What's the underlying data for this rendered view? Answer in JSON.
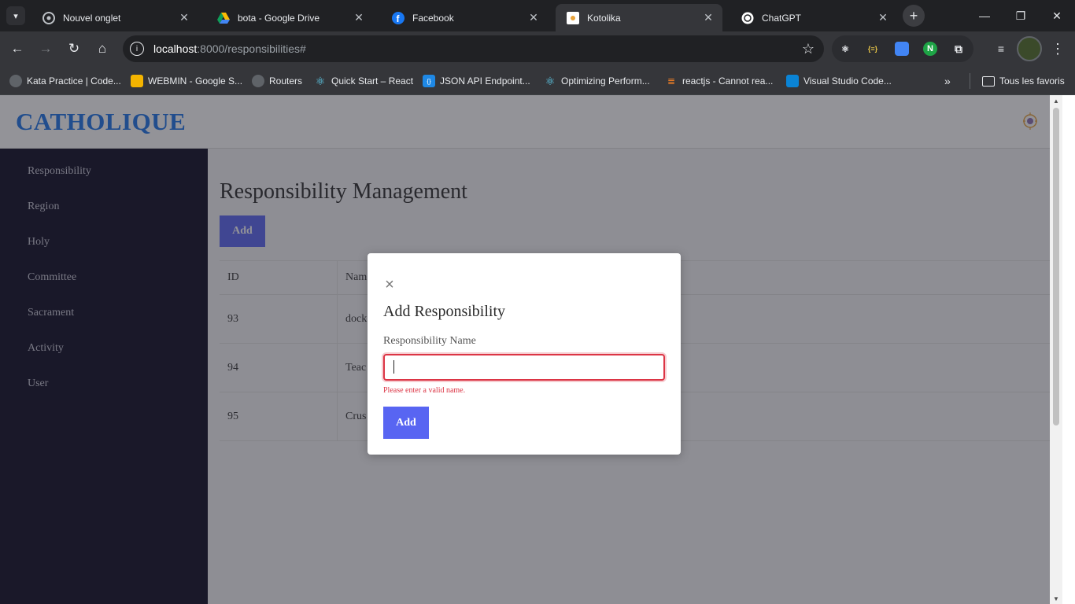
{
  "browser": {
    "tabs": [
      {
        "title": "Nouvel onglet",
        "icon": "chrome-icon"
      },
      {
        "title": "bota - Google Drive",
        "icon": "google-drive-icon"
      },
      {
        "title": "Facebook",
        "icon": "facebook-icon"
      },
      {
        "title": "Kotolika",
        "icon": "kotolika-favicon"
      },
      {
        "title": "ChatGPT",
        "icon": "chatgpt-icon"
      }
    ],
    "active_tab": 3,
    "url_host": "localhost",
    "url_rest": ":8000/responsibilities#",
    "bookmarks": [
      {
        "label": "Kata Practice | Code...",
        "icon": "globe-icon"
      },
      {
        "label": "WEBMIN - Google S...",
        "icon": "google-slides-icon"
      },
      {
        "label": "Routers",
        "icon": "globe-icon"
      },
      {
        "label": "Quick Start – React",
        "icon": "react-icon"
      },
      {
        "label": "JSON API Endpoint...",
        "icon": "json-api-icon"
      },
      {
        "label": "Optimizing Perform...",
        "icon": "react-icon"
      },
      {
        "label": "reactjs - Cannot rea...",
        "icon": "stackoverflow-icon"
      },
      {
        "label": "Visual Studio Code...",
        "icon": "vscode-icon"
      }
    ],
    "all_bookmarks_label": "Tous les favoris"
  },
  "app": {
    "brand": "CATHOLIQUE",
    "sidebar": [
      "Responsibility",
      "Region",
      "Holy",
      "Committee",
      "Sacrament",
      "Activity",
      "User"
    ],
    "page_title": "Responsibility Management",
    "add_label": "Add",
    "table": {
      "headers": [
        "ID",
        "Nam"
      ],
      "rows": [
        {
          "id": "93",
          "name": "dock"
        },
        {
          "id": "94",
          "name": "Teac"
        },
        {
          "id": "95",
          "name": "Crus"
        }
      ]
    }
  },
  "modal": {
    "close_icon": "close-icon",
    "title": "Add Responsibility",
    "field_label": "Responsibility Name",
    "field_value": "",
    "error": "Please enter a valid name.",
    "submit_label": "Add"
  },
  "colors": {
    "brand": "#1a73e8",
    "sidebar_bg": "#0b0820",
    "button": "#5865f2",
    "error": "#dc3545"
  }
}
